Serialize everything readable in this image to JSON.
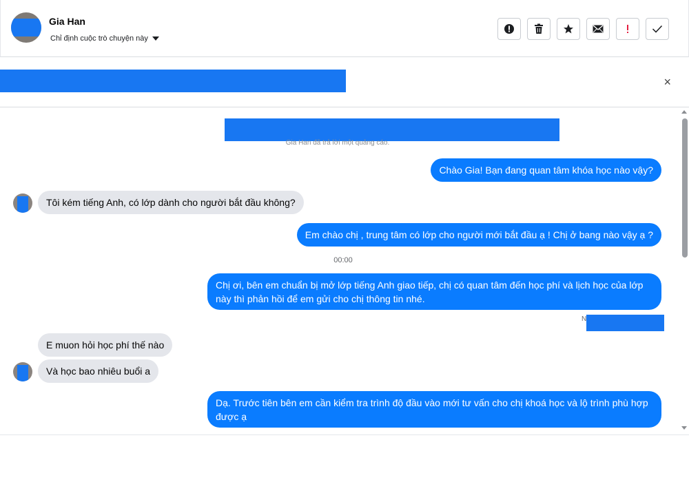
{
  "header": {
    "contact_name": "Gia Han",
    "assign_label": "Chỉ định cuộc trò chuyện này",
    "actions": [
      "alert-circle-icon",
      "trash-icon",
      "star-icon",
      "mail-icon",
      "exclamation-icon",
      "check-icon"
    ]
  },
  "banner": {
    "close_label": "×"
  },
  "thread": {
    "ad_note": "Gia Han đã trả lời một quảng cáo.",
    "timestamp": "00:00",
    "seen_prefix": "N",
    "messages": [
      {
        "from": "me",
        "text": "Chào Gia! Bạn đang quan tâm khóa học nào vậy?"
      },
      {
        "from": "them",
        "text": "Tôi kém tiếng Anh, có lớp dành cho người bắt đầu không?"
      },
      {
        "from": "me",
        "text": "Em chào chị , trung tâm có lớp cho người mới bắt đầu ạ ! Chị ở bang nào vậy ạ ?"
      },
      {
        "from": "me",
        "text": "Chị ơi, bên em chuẩn bị mở lớp tiếng Anh giao tiếp, chị có quan tâm đến học phí và lịch học của lớp này thì phản hồi để em gửi cho chị thông tin nhé."
      },
      {
        "from": "them",
        "text": "E muon hỏi học phí thế nào"
      },
      {
        "from": "them",
        "text": "Và học bao nhiêu buổi a"
      },
      {
        "from": "me",
        "text": "Dạ. Trước tiên bên em cần kiểm tra trình độ đầu vào mới tư vấn cho chị khoá học và lộ trình phù hợp được ạ"
      }
    ]
  },
  "colors": {
    "accent": "#1877f2",
    "outgoing_bubble": "#0a7cff",
    "incoming_bubble": "#e4e6eb",
    "danger": "#e41e3f"
  }
}
